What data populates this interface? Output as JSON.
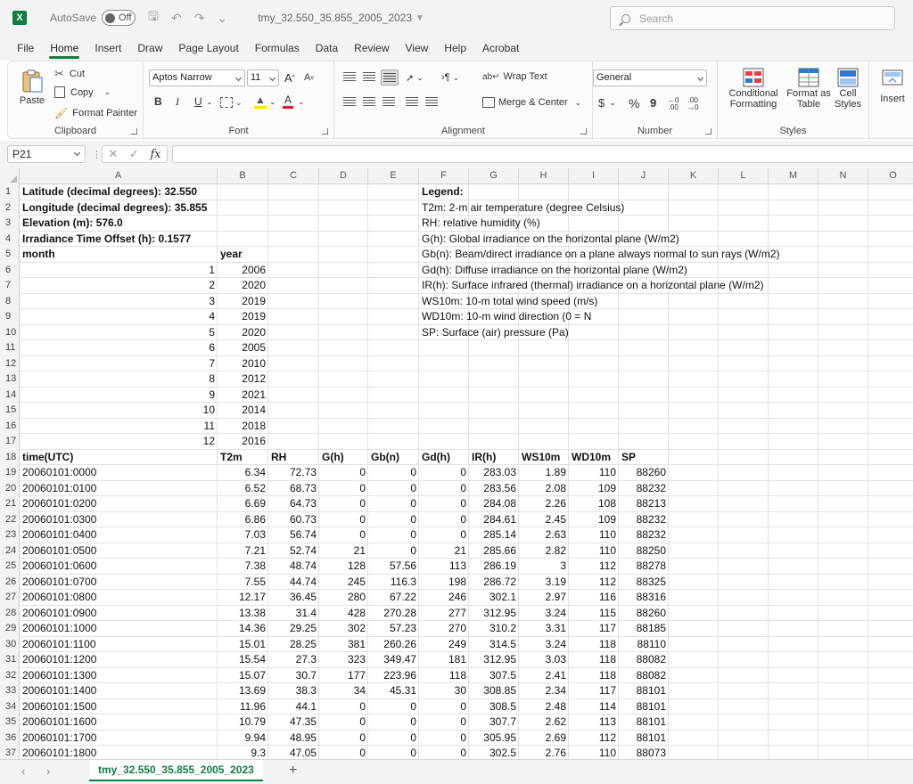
{
  "titlebar": {
    "app_icon": "X",
    "autosave_label": "AutoSave",
    "autosave_state": "Off",
    "filename": "tmy_32.550_35.855_2005_2023",
    "search_placeholder": "Search"
  },
  "menu": [
    "File",
    "Home",
    "Insert",
    "Draw",
    "Page Layout",
    "Formulas",
    "Data",
    "Review",
    "View",
    "Help",
    "Acrobat"
  ],
  "active_menu": "Home",
  "ribbon": {
    "clipboard": {
      "paste": "Paste",
      "cut": "Cut",
      "copy": "Copy",
      "format_painter": "Format Painter",
      "label": "Clipboard"
    },
    "font": {
      "font_name": "Aptos Narrow",
      "font_size": "11",
      "bold": "B",
      "italic": "I",
      "underline": "U",
      "grow": "A^",
      "shrink": "A^",
      "color_letter": "A",
      "label": "Font",
      "font_color": "#e81123",
      "fill_color": "#ffe600"
    },
    "alignment": {
      "wrap_text": "Wrap Text",
      "merge_center": "Merge & Center",
      "label": "Alignment"
    },
    "number": {
      "format": "General",
      "currency": "$",
      "percent": "%",
      "comma": "9",
      "label": "Number"
    },
    "styles": {
      "conditional1": "Conditional",
      "conditional2": "Formatting",
      "format_as1": "Format as",
      "format_as2": "Table",
      "cell1": "Cell",
      "cell2": "Styles",
      "label": "Styles"
    },
    "cells": {
      "insert": "Insert"
    }
  },
  "formula_bar": {
    "name_box": "P21",
    "fx": "fx",
    "content": ""
  },
  "columns": [
    "A",
    "B",
    "C",
    "D",
    "E",
    "F",
    "G",
    "H",
    "I",
    "J",
    "K",
    "L",
    "M",
    "N",
    "O"
  ],
  "rows": [
    "1",
    "2",
    "3",
    "4",
    "5",
    "6",
    "7",
    "8",
    "9",
    "10",
    "11",
    "12",
    "13",
    "14",
    "15",
    "16",
    "17",
    "18",
    "19",
    "20",
    "21",
    "22",
    "23",
    "24",
    "25",
    "26",
    "27",
    "28",
    "29",
    "30",
    "31",
    "32",
    "33",
    "34",
    "35",
    "36",
    "37"
  ],
  "header_info": [
    "Latitude (decimal degrees): 32.550",
    "Longitude (decimal degrees): 35.855",
    "Elevation (m): 576.0",
    "Irradiance Time Offset (h): 0.1577"
  ],
  "legend": [
    "Legend:",
    "T2m: 2-m air temperature (degree Celsius)",
    "RH: relative humidity (%)",
    "G(h): Global irradiance on the horizontal plane (W/m2)",
    "Gb(n): Beam/direct irradiance on a plane always normal to sun rays (W/m2)",
    "Gd(h): Diffuse irradiance on the horizontal plane (W/m2)",
    "IR(h): Surface infrared (thermal) irradiance on a horizontal plane (W/m2)",
    "WS10m: 10-m total wind speed (m/s)",
    "WD10m: 10-m wind direction (0 = N",
    "SP: Surface (air) pressure (Pa)"
  ],
  "month_year": {
    "headers": [
      "month",
      "year"
    ],
    "rows": [
      [
        "1",
        "2006"
      ],
      [
        "2",
        "2020"
      ],
      [
        "3",
        "2019"
      ],
      [
        "4",
        "2019"
      ],
      [
        "5",
        "2020"
      ],
      [
        "6",
        "2005"
      ],
      [
        "7",
        "2010"
      ],
      [
        "8",
        "2012"
      ],
      [
        "9",
        "2021"
      ],
      [
        "10",
        "2014"
      ],
      [
        "11",
        "2018"
      ],
      [
        "12",
        "2016"
      ]
    ]
  },
  "data_table": {
    "headers": [
      "time(UTC)",
      "T2m",
      "RH",
      "G(h)",
      "Gb(n)",
      "Gd(h)",
      "IR(h)",
      "WS10m",
      "WD10m",
      "SP"
    ],
    "rows": [
      [
        "20060101:0000",
        "6.34",
        "72.73",
        "0",
        "0",
        "0",
        "283.03",
        "1.89",
        "110",
        "88260"
      ],
      [
        "20060101:0100",
        "6.52",
        "68.73",
        "0",
        "0",
        "0",
        "283.56",
        "2.08",
        "109",
        "88232"
      ],
      [
        "20060101:0200",
        "6.69",
        "64.73",
        "0",
        "0",
        "0",
        "284.08",
        "2.26",
        "108",
        "88213"
      ],
      [
        "20060101:0300",
        "6.86",
        "60.73",
        "0",
        "0",
        "0",
        "284.61",
        "2.45",
        "109",
        "88232"
      ],
      [
        "20060101:0400",
        "7.03",
        "56.74",
        "0",
        "0",
        "0",
        "285.14",
        "2.63",
        "110",
        "88232"
      ],
      [
        "20060101:0500",
        "7.21",
        "52.74",
        "21",
        "0",
        "21",
        "285.66",
        "2.82",
        "110",
        "88250"
      ],
      [
        "20060101:0600",
        "7.38",
        "48.74",
        "128",
        "57.56",
        "113",
        "286.19",
        "3",
        "112",
        "88278"
      ],
      [
        "20060101:0700",
        "7.55",
        "44.74",
        "245",
        "116.3",
        "198",
        "286.72",
        "3.19",
        "112",
        "88325"
      ],
      [
        "20060101:0800",
        "12.17",
        "36.45",
        "280",
        "67.22",
        "246",
        "302.1",
        "2.97",
        "116",
        "88316"
      ],
      [
        "20060101:0900",
        "13.38",
        "31.4",
        "428",
        "270.28",
        "277",
        "312.95",
        "3.24",
        "115",
        "88260"
      ],
      [
        "20060101:1000",
        "14.36",
        "29.25",
        "302",
        "57.23",
        "270",
        "310.2",
        "3.31",
        "117",
        "88185"
      ],
      [
        "20060101:1100",
        "15.01",
        "28.25",
        "381",
        "260.26",
        "249",
        "314.5",
        "3.24",
        "118",
        "88110"
      ],
      [
        "20060101:1200",
        "15.54",
        "27.3",
        "323",
        "349.47",
        "181",
        "312.95",
        "3.03",
        "118",
        "88082"
      ],
      [
        "20060101:1300",
        "15.07",
        "30.7",
        "177",
        "223.96",
        "118",
        "307.5",
        "2.41",
        "118",
        "88082"
      ],
      [
        "20060101:1400",
        "13.69",
        "38.3",
        "34",
        "45.31",
        "30",
        "308.85",
        "2.34",
        "117",
        "88101"
      ],
      [
        "20060101:1500",
        "11.96",
        "44.1",
        "0",
        "0",
        "0",
        "308.5",
        "2.48",
        "114",
        "88101"
      ],
      [
        "20060101:1600",
        "10.79",
        "47.35",
        "0",
        "0",
        "0",
        "307.7",
        "2.62",
        "113",
        "88101"
      ],
      [
        "20060101:1700",
        "9.94",
        "48.95",
        "0",
        "0",
        "0",
        "305.95",
        "2.69",
        "112",
        "88101"
      ],
      [
        "20060101:1800",
        "9.3",
        "47.05",
        "0",
        "0",
        "0",
        "302.5",
        "2.76",
        "110",
        "88073"
      ]
    ]
  },
  "sheet_tabs": [
    "tmy_32.550_35.855_2005_2023"
  ],
  "add_sheet": "+"
}
